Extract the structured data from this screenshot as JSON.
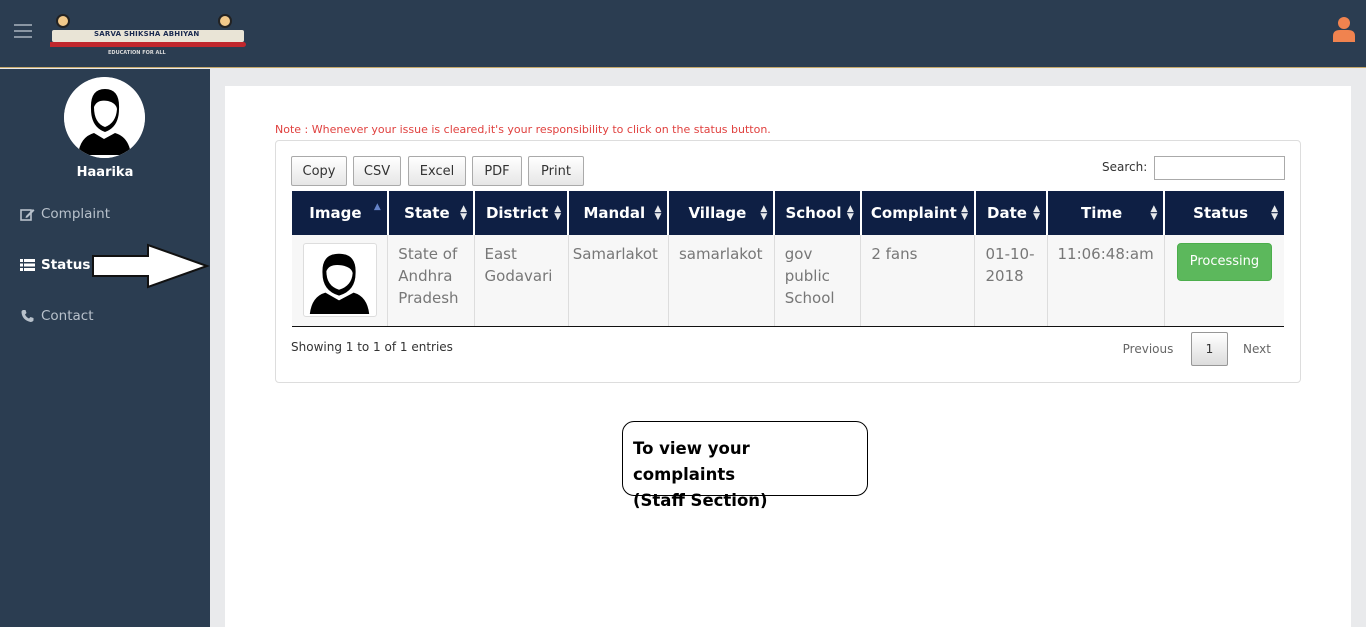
{
  "header": {
    "logo_title": "SARVA SHIKSHA ABHIYAN",
    "logo_tagline": "EDUCATION FOR ALL",
    "menu_icon": "hamburger-icon",
    "user_icon": "user-icon",
    "user_icon_color": "#f0834f"
  },
  "sidebar": {
    "username": "Haarika",
    "items": [
      {
        "label": "Complaint",
        "icon": "edit-icon"
      },
      {
        "label": "Status",
        "icon": "list-icon",
        "active": true
      },
      {
        "label": "Contact",
        "icon": "phone-icon"
      }
    ]
  },
  "main": {
    "note": "Note : Whenever your issue is cleared,it's your responsibility to click on the status button.",
    "export_buttons": [
      "Copy",
      "CSV",
      "Excel",
      "PDF",
      "Print"
    ],
    "search_label": "Search:",
    "search_value": "",
    "columns": [
      "Image",
      "State",
      "District",
      "Mandal",
      "Village",
      "School",
      "Complaint",
      "Date",
      "Time",
      "Status"
    ],
    "rows": [
      {
        "image": "person-avatar",
        "state": "State of Andhra Pradesh",
        "district": "East Godavari",
        "mandal": "Samarlakot",
        "village": "samarlakot",
        "school": "gov public School",
        "complaint": "2 fans",
        "date": "01-10-2018",
        "time": "11:06:48:am",
        "status": "Processing"
      }
    ],
    "info": "Showing 1 to 1 of 1 entries",
    "pagination": {
      "previous": "Previous",
      "current": "1",
      "next": "Next"
    }
  },
  "callout": {
    "line1": "To view your complaints",
    "line2": "(Staff Section)"
  },
  "colors": {
    "nav_bg": "#2b3d51",
    "table_header": "#0e1f44",
    "status_button": "#5cb85c",
    "note_text": "#e0413f"
  }
}
